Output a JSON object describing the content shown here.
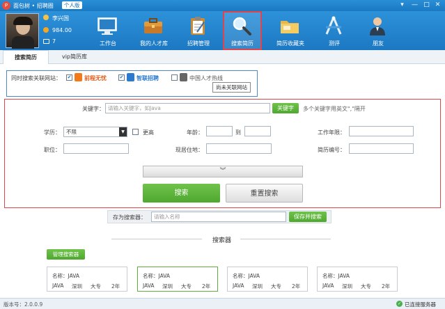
{
  "title": {
    "app_name": "面包树 • 招聘圈",
    "edition": "个人版"
  },
  "user": {
    "name": "李兴国",
    "points": "984.00",
    "messages": "7"
  },
  "nav": [
    {
      "label": "工作台"
    },
    {
      "label": "我的人才库"
    },
    {
      "label": "招聘管理"
    },
    {
      "label": "搜索简历"
    },
    {
      "label": "简历收藏夹"
    },
    {
      "label": "测评"
    },
    {
      "label": "朋友"
    }
  ],
  "tabs": [
    {
      "label": "搜索简历"
    },
    {
      "label": "vip简历库"
    }
  ],
  "sites": {
    "prefix": "同时搜索关联网站：",
    "site1": "前程无忧",
    "site2": "智联招聘",
    "site3": "中国人才热线",
    "unlinked_label": "尚未关联网站"
  },
  "search": {
    "keyword_label": "关键字：",
    "keyword_placeholder": "请输入关键字，如Java",
    "keyword_btn": "关键字",
    "keyword_hint": "多个关键字用英文\",\"隔开",
    "edu_label": "学历：",
    "edu_value": "不限",
    "above_label": "更高",
    "age_label": "年龄：",
    "age_to": "到",
    "years_label": "工作年限：",
    "position_label": "职位：",
    "location_label": "现居住地：",
    "resume_no_label": "简历编号：",
    "search_btn": "搜索",
    "reset_btn": "重置搜索"
  },
  "save": {
    "label": "存为搜索器：",
    "placeholder": "请输入名称",
    "button": "保存并搜索"
  },
  "searchers": {
    "heading": "搜索器",
    "manage_btn": "管理搜索器",
    "cards": [
      {
        "name": "名称：JAVA",
        "kw": "JAVA",
        "city": "深圳",
        "edu": "大专",
        "years": "2年"
      },
      {
        "name": "名称：JAVA",
        "kw": "JAVA",
        "city": "深圳",
        "edu": "大专",
        "years": "2年"
      },
      {
        "name": "名称：JAVA",
        "kw": "JAVA",
        "city": "深圳",
        "edu": "大专",
        "years": "2年"
      },
      {
        "name": "名称：JAVA",
        "kw": "JAVA",
        "city": "深圳",
        "edu": "大专",
        "years": "2年"
      }
    ]
  },
  "status": {
    "version": "版本号：2.0.0.9",
    "connection": "已连接服务器"
  }
}
